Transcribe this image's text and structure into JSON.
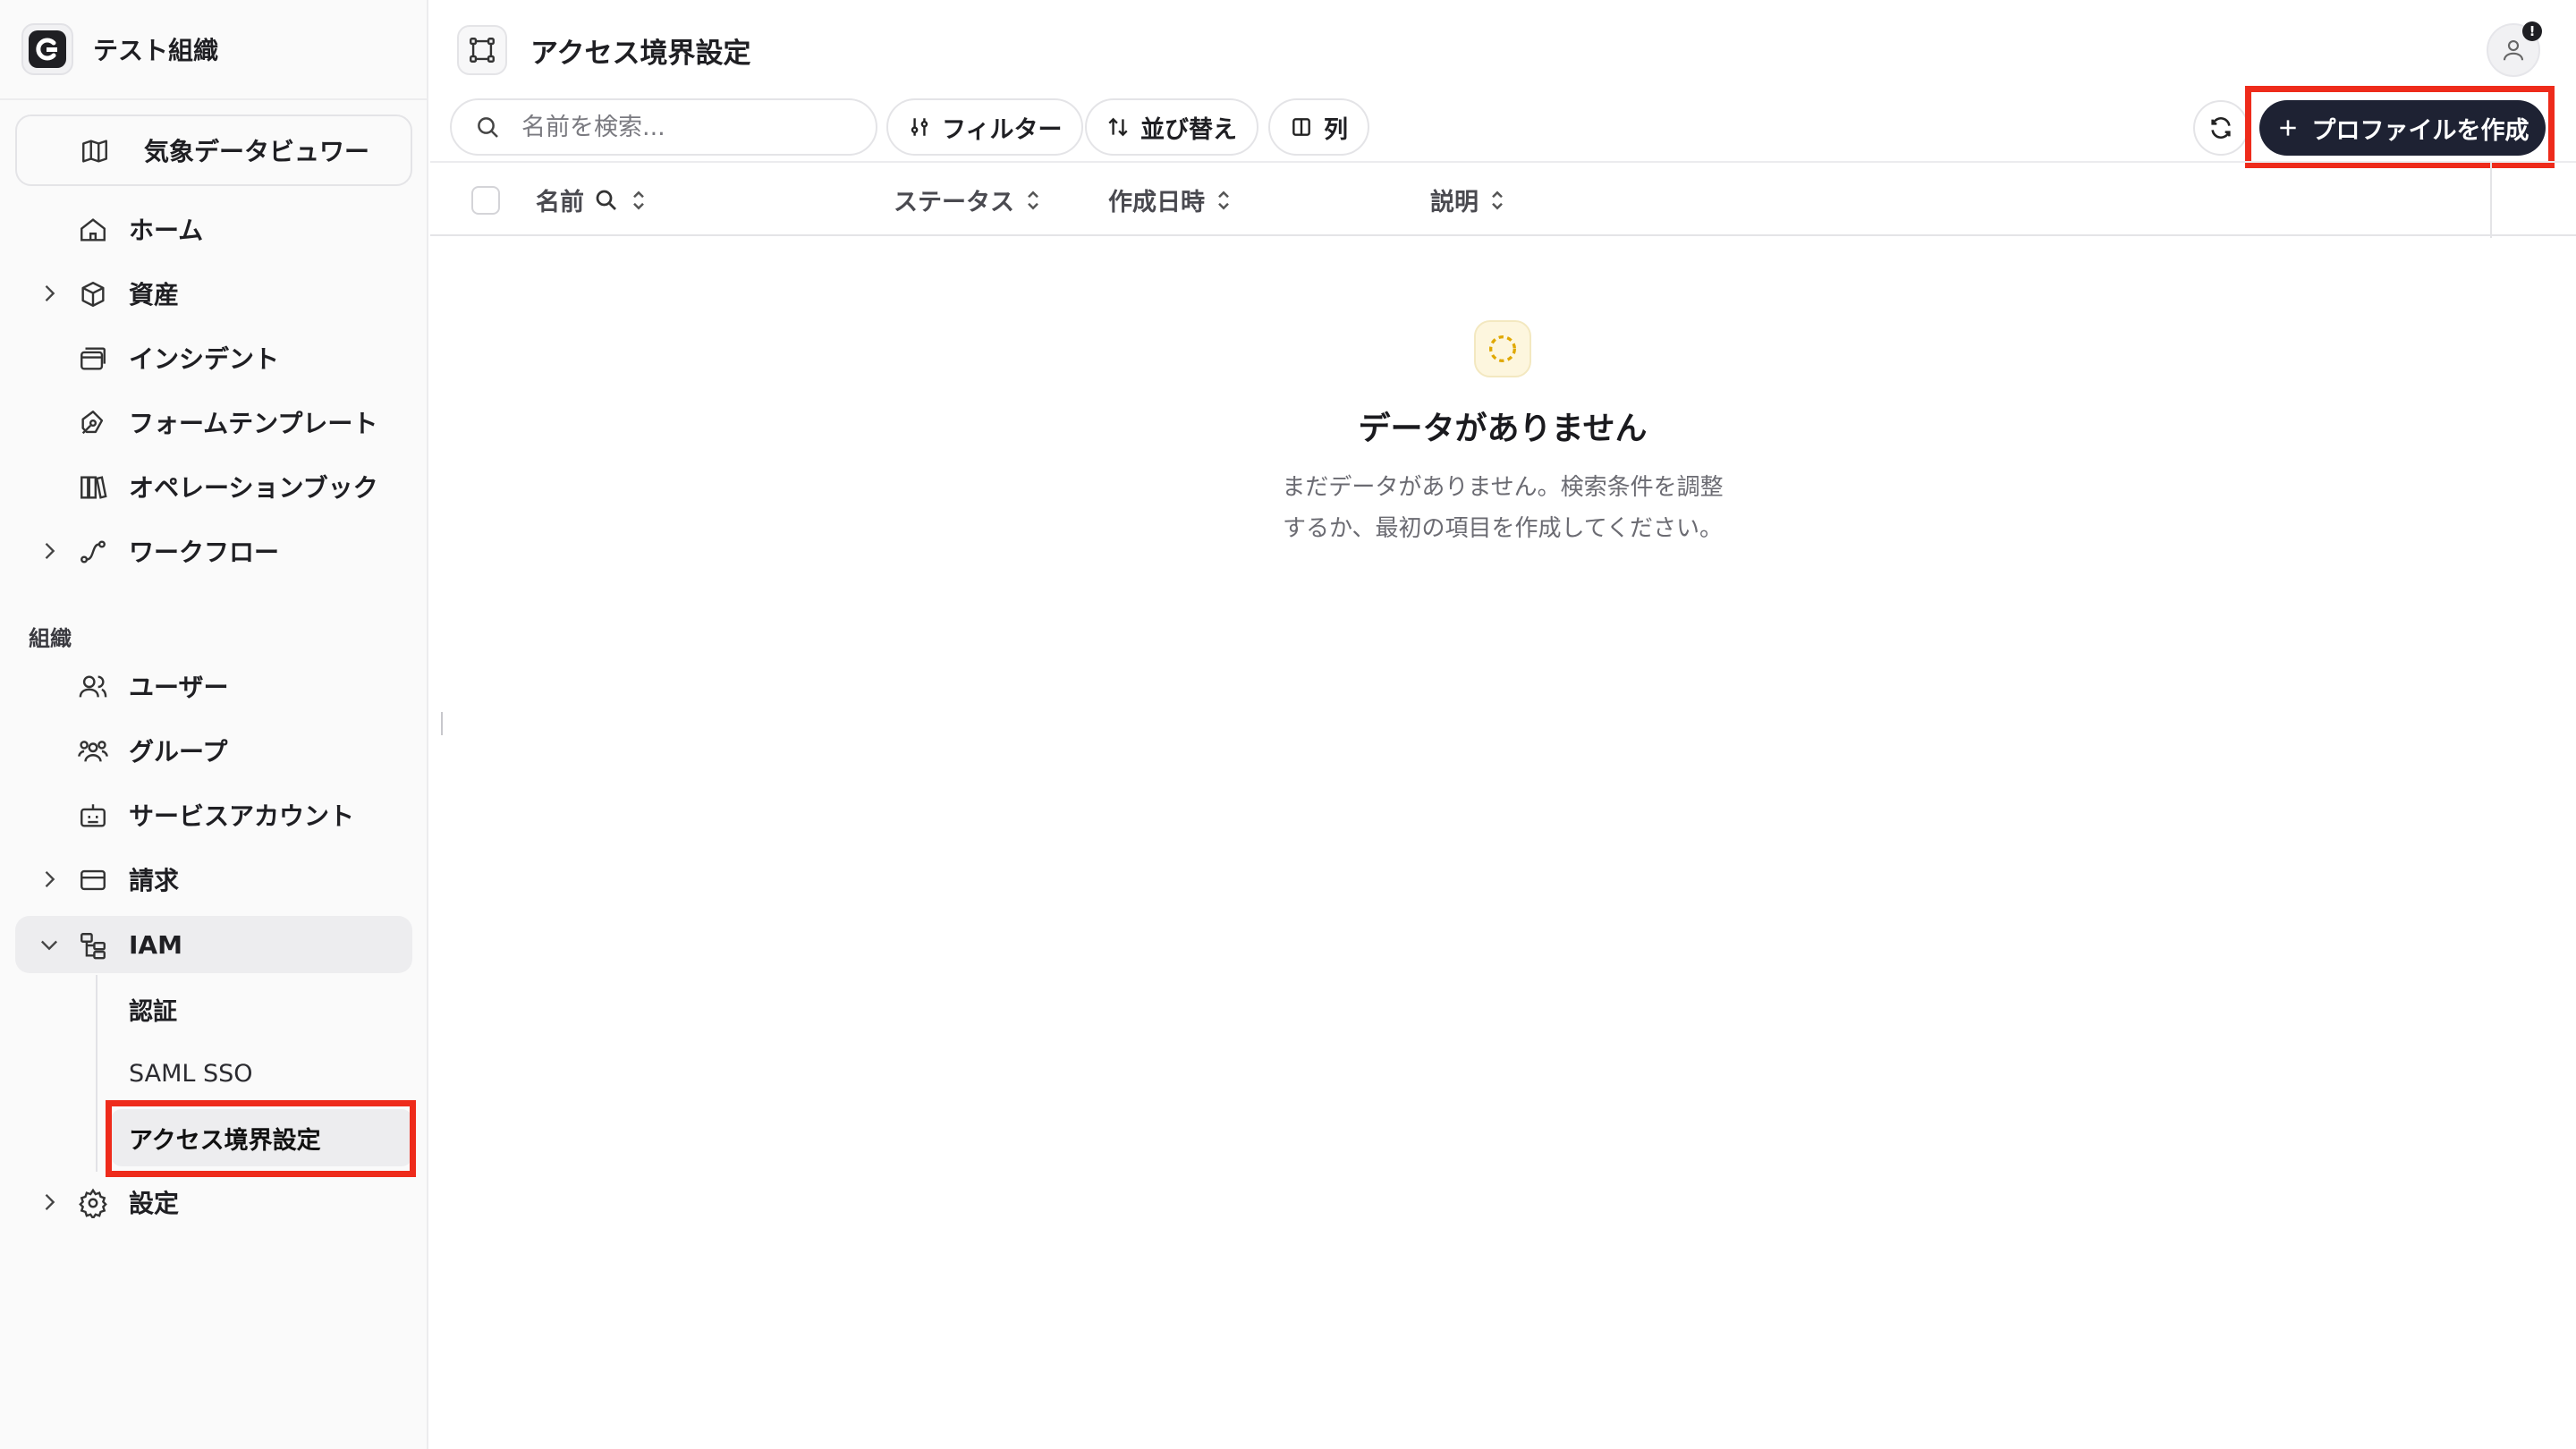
{
  "org": {
    "name": "テスト組織"
  },
  "sidebar": {
    "pinned": {
      "label": "気象データビュワー"
    },
    "items": [
      {
        "label": "ホーム"
      },
      {
        "label": "資産"
      },
      {
        "label": "インシデント"
      },
      {
        "label": "フォームテンプレート"
      },
      {
        "label": "オペレーションブック"
      },
      {
        "label": "ワークフロー"
      }
    ],
    "section_label": "組織",
    "org_items": [
      {
        "label": "ユーザー"
      },
      {
        "label": "グループ"
      },
      {
        "label": "サービスアカウント"
      },
      {
        "label": "請求"
      },
      {
        "label": "IAM"
      }
    ],
    "iam_sub": [
      {
        "label": "認証"
      },
      {
        "label": "SAML SSO"
      },
      {
        "label": "アクセス境界設定"
      }
    ],
    "settings": {
      "label": "設定"
    }
  },
  "header": {
    "title": "アクセス境界設定",
    "avatar_badge": "!"
  },
  "toolbar": {
    "search_placeholder": "名前を検索...",
    "filter_label": "フィルター",
    "sort_label": "並び替え",
    "columns_label": "列",
    "create_label": "プロファイルを作成"
  },
  "table": {
    "columns": [
      "名前",
      "ステータス",
      "作成日時",
      "説明"
    ]
  },
  "empty_state": {
    "title": "データがありません",
    "desc_line1": "まだデータがありません。検索条件を調整",
    "desc_line2": "するか、最初の項目を作成してください。"
  },
  "colors": {
    "primary_button": "#1e2233",
    "highlight": "#ee2b1b",
    "empty_icon_accent": "#e0a800"
  }
}
